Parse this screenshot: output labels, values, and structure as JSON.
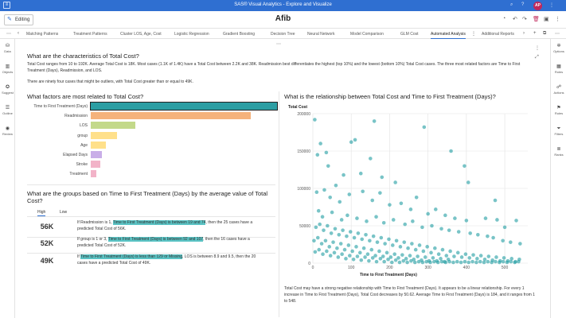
{
  "app": {
    "title": "SAS® Visual Analytics - Explore and Visualize",
    "avatar_initials": "AP"
  },
  "toolbar": {
    "editing_label": "Editing",
    "report_title": "Afib"
  },
  "tabs": [
    {
      "label": "Matching Patterns"
    },
    {
      "label": "Treatment Patterns"
    },
    {
      "label": "Cluster LOS, Age, Cost"
    },
    {
      "label": "Logistic Regression"
    },
    {
      "label": "Gradient Boosting"
    },
    {
      "label": "Decision Tree"
    },
    {
      "label": "Neural Network"
    },
    {
      "label": "Model Comparison"
    },
    {
      "label": "GLM Cost"
    },
    {
      "label": "Automated Analysis"
    },
    {
      "label": "Additional Reports"
    }
  ],
  "left_rail": [
    {
      "label": "Data",
      "icon": "database-icon"
    },
    {
      "label": "Objects",
      "icon": "objects-icon"
    },
    {
      "label": "Suggest",
      "icon": "lightbulb-icon"
    },
    {
      "label": "Outline",
      "icon": "outline-icon"
    },
    {
      "label": "Review",
      "icon": "review-icon"
    }
  ],
  "right_rail": [
    {
      "label": "Options",
      "icon": "options-icon"
    },
    {
      "label": "Roles",
      "icon": "roles-icon"
    },
    {
      "label": "Actions",
      "icon": "actions-icon"
    },
    {
      "label": "Rules",
      "icon": "rules-icon"
    },
    {
      "label": "Filters",
      "icon": "filter-icon"
    },
    {
      "label": "Ranks",
      "icon": "ranks-icon"
    }
  ],
  "characteristics": {
    "heading": "What are the characteristics of Total Cost?",
    "para1": "Total Cost ranges from 10 to 192K. Average Total Cost is 18K. Most cases (1.1K of 1.4K) have a Total Cost between 2.2K and 38K. Readmission best differentiates the highest (top 10%) and the lowest (bottom 10%) Total Cost cases. The three most related factors are Time to First Treatment (Days), Readmission, and LOS.",
    "para2": "There are ninety four cases that might be outliers, with Total Cost greater than or equal to 49K."
  },
  "factors": {
    "heading": "What factors are most related to Total Cost?",
    "colors": {
      "top": "#2b9ea3",
      "second": "#f5b27c",
      "third": "#c3d98a",
      "rest": "#ffe08a",
      "low": "#c9aee8",
      "lowest": "#f2b3c8"
    },
    "items": [
      {
        "label": "Time to First Treatment (Days)",
        "value": 1.0
      },
      {
        "label": "Readmission",
        "value": 0.86
      },
      {
        "label": "LOS",
        "value": 0.24
      },
      {
        "label": "group",
        "value": 0.14
      },
      {
        "label": "Age",
        "value": 0.08
      },
      {
        "label": "Elapsed Days",
        "value": 0.06
      },
      {
        "label": "Stroke",
        "value": 0.05
      },
      {
        "label": "Treatment",
        "value": 0.03
      }
    ]
  },
  "groups": {
    "heading": "What are the groups based on Time to First Treatment (Days) by the average value of Total Cost?",
    "tab_high": "High",
    "tab_low": "Low",
    "rows": [
      {
        "value": "56K",
        "pre": "If Readmission is 1, ",
        "hl": "Time to First Treatment (Days) is between 19 and 74",
        "post": ", then the 25 cases have a predicted Total Cost of 56K."
      },
      {
        "value": "52K",
        "pre": "If group is 1 or 3, ",
        "hl": "Time to First Treatment (Days) is between 92 and 107",
        "post": ", then the 16 cases have a predicted Total Cost of 52K."
      },
      {
        "value": "49K",
        "pre": "If ",
        "hl": "Time to First Treatment (Days) is less than 129 or Missing",
        "post": ", LOS is between 8.9 and 9.5, then the 20 cases have a predicted Total Cost of 49K."
      }
    ]
  },
  "relationship": {
    "heading": "What is the relationship between Total Cost and Time to First Treatment (Days)?",
    "summary": "Total Cost may have a strong negative relationship with Time to First Treatment (Days). It appears to be a linear relationship. For every 1 increase in Time to First Treatment (Days), Total Cost decreases by 50.62. Average Time to First Treatment (Days) is 184, and it ranges from 1 to 548."
  },
  "chart_data": {
    "type": "scatter",
    "title": "",
    "xlabel": "Time to First Treatment (Days)",
    "ylabel": "Total Cost",
    "xlim": [
      0,
      560
    ],
    "ylim": [
      0,
      200000
    ],
    "xticks": [
      0,
      100,
      200,
      300,
      400,
      500
    ],
    "yticks": [
      0,
      50000,
      100000,
      150000,
      200000
    ],
    "ytick_labels": [
      "0",
      "50000",
      "100000",
      "150000",
      "200000"
    ],
    "grid": true,
    "color": "#1f9da2",
    "points": [
      [
        5,
        192000
      ],
      [
        20,
        160000
      ],
      [
        12,
        145000
      ],
      [
        35,
        148000
      ],
      [
        40,
        130000
      ],
      [
        160,
        190000
      ],
      [
        110,
        165000
      ],
      [
        100,
        162000
      ],
      [
        125,
        120000
      ],
      [
        180,
        115000
      ],
      [
        215,
        108000
      ],
      [
        290,
        182000
      ],
      [
        360,
        150000
      ],
      [
        395,
        130000
      ],
      [
        405,
        108000
      ],
      [
        150,
        140000
      ],
      [
        80,
        118000
      ],
      [
        60,
        104000
      ],
      [
        400,
        57000
      ],
      [
        475,
        84000
      ],
      [
        480,
        58000
      ],
      [
        530,
        57000
      ],
      [
        500,
        48000
      ],
      [
        450,
        60000
      ],
      [
        10,
        95000
      ],
      [
        30,
        98000
      ],
      [
        45,
        88000
      ],
      [
        70,
        82000
      ],
      [
        95,
        92000
      ],
      [
        130,
        96000
      ],
      [
        155,
        84000
      ],
      [
        175,
        94000
      ],
      [
        200,
        78000
      ],
      [
        230,
        80000
      ],
      [
        255,
        72000
      ],
      [
        270,
        88000
      ],
      [
        300,
        66000
      ],
      [
        320,
        72000
      ],
      [
        345,
        64000
      ],
      [
        370,
        60000
      ],
      [
        15,
        70000
      ],
      [
        25,
        62000
      ],
      [
        50,
        68000
      ],
      [
        75,
        58000
      ],
      [
        90,
        64000
      ],
      [
        115,
        60000
      ],
      [
        140,
        56000
      ],
      [
        165,
        62000
      ],
      [
        185,
        54000
      ],
      [
        210,
        58000
      ],
      [
        240,
        52000
      ],
      [
        260,
        56000
      ],
      [
        285,
        48000
      ],
      [
        310,
        50000
      ],
      [
        335,
        46000
      ],
      [
        355,
        44000
      ],
      [
        380,
        42000
      ],
      [
        410,
        40000
      ],
      [
        430,
        38000
      ],
      [
        455,
        36000
      ],
      [
        470,
        34000
      ],
      [
        495,
        30000
      ],
      [
        515,
        28000
      ],
      [
        540,
        26000
      ],
      [
        8,
        48000
      ],
      [
        18,
        52000
      ],
      [
        28,
        44000
      ],
      [
        38,
        50000
      ],
      [
        48,
        40000
      ],
      [
        58,
        46000
      ],
      [
        68,
        38000
      ],
      [
        78,
        44000
      ],
      [
        88,
        36000
      ],
      [
        98,
        42000
      ],
      [
        108,
        34000
      ],
      [
        118,
        40000
      ],
      [
        128,
        32000
      ],
      [
        138,
        38000
      ],
      [
        148,
        30000
      ],
      [
        158,
        36000
      ],
      [
        168,
        28000
      ],
      [
        178,
        34000
      ],
      [
        188,
        26000
      ],
      [
        198,
        32000
      ],
      [
        208,
        24000
      ],
      [
        218,
        30000
      ],
      [
        228,
        22000
      ],
      [
        238,
        28000
      ],
      [
        248,
        20000
      ],
      [
        258,
        26000
      ],
      [
        268,
        18000
      ],
      [
        278,
        24000
      ],
      [
        288,
        16000
      ],
      [
        298,
        22000
      ],
      [
        308,
        14000
      ],
      [
        318,
        20000
      ],
      [
        328,
        12000
      ],
      [
        338,
        18000
      ],
      [
        348,
        10000
      ],
      [
        358,
        16000
      ],
      [
        368,
        9000
      ],
      [
        378,
        14000
      ],
      [
        388,
        8000
      ],
      [
        398,
        12000
      ],
      [
        408,
        7000
      ],
      [
        418,
        11000
      ],
      [
        428,
        6000
      ],
      [
        438,
        10000
      ],
      [
        448,
        5000
      ],
      [
        458,
        9000
      ],
      [
        468,
        4000
      ],
      [
        478,
        8000
      ],
      [
        488,
        3000
      ],
      [
        498,
        7000
      ],
      [
        508,
        3000
      ],
      [
        518,
        6000
      ],
      [
        528,
        2000
      ],
      [
        538,
        5000
      ],
      [
        3,
        30000
      ],
      [
        13,
        34000
      ],
      [
        23,
        26000
      ],
      [
        33,
        30000
      ],
      [
        43,
        22000
      ],
      [
        53,
        28000
      ],
      [
        63,
        20000
      ],
      [
        73,
        26000
      ],
      [
        83,
        18000
      ],
      [
        93,
        24000
      ],
      [
        103,
        16000
      ],
      [
        113,
        22000
      ],
      [
        123,
        14000
      ],
      [
        133,
        20000
      ],
      [
        143,
        12000
      ],
      [
        153,
        18000
      ],
      [
        163,
        10000
      ],
      [
        173,
        16000
      ],
      [
        183,
        9000
      ],
      [
        193,
        14000
      ],
      [
        203,
        8000
      ],
      [
        213,
        12000
      ],
      [
        223,
        7000
      ],
      [
        233,
        11000
      ],
      [
        243,
        6000
      ],
      [
        253,
        10000
      ],
      [
        263,
        5000
      ],
      [
        273,
        9000
      ],
      [
        283,
        4000
      ],
      [
        293,
        8000
      ],
      [
        303,
        3000
      ],
      [
        313,
        7000
      ],
      [
        323,
        3000
      ],
      [
        333,
        6000
      ],
      [
        343,
        2000
      ],
      [
        353,
        5000
      ],
      [
        6,
        15000
      ],
      [
        16,
        18000
      ],
      [
        26,
        12000
      ],
      [
        36,
        16000
      ],
      [
        46,
        10000
      ],
      [
        56,
        14000
      ],
      [
        66,
        8000
      ],
      [
        76,
        12000
      ],
      [
        86,
        6000
      ],
      [
        96,
        10000
      ],
      [
        106,
        5000
      ],
      [
        116,
        9000
      ],
      [
        126,
        4000
      ],
      [
        136,
        8000
      ],
      [
        146,
        3000
      ],
      [
        156,
        7000
      ],
      [
        166,
        2000
      ],
      [
        176,
        6000
      ],
      [
        186,
        2000
      ],
      [
        196,
        5000
      ],
      [
        206,
        1000
      ],
      [
        216,
        4000
      ],
      [
        226,
        1000
      ],
      [
        236,
        3000
      ],
      [
        246,
        1000
      ],
      [
        256,
        3000
      ],
      [
        266,
        1000
      ],
      [
        276,
        2000
      ],
      [
        286,
        1000
      ],
      [
        296,
        2000
      ],
      [
        306,
        1000
      ],
      [
        316,
        2000
      ],
      [
        326,
        1000
      ],
      [
        336,
        2000
      ],
      [
        346,
        1000
      ],
      [
        356,
        2000
      ],
      [
        366,
        1000
      ],
      [
        376,
        2000
      ],
      [
        386,
        1000
      ],
      [
        396,
        2000
      ],
      [
        406,
        1000
      ],
      [
        416,
        2000
      ],
      [
        426,
        1000
      ],
      [
        436,
        2000
      ],
      [
        446,
        1000
      ],
      [
        456,
        2000
      ],
      [
        466,
        1000
      ],
      [
        476,
        2000
      ],
      [
        486,
        1000
      ],
      [
        496,
        2000
      ],
      [
        506,
        1000
      ],
      [
        516,
        2000
      ],
      [
        526,
        1000
      ],
      [
        536,
        2000
      ]
    ]
  }
}
